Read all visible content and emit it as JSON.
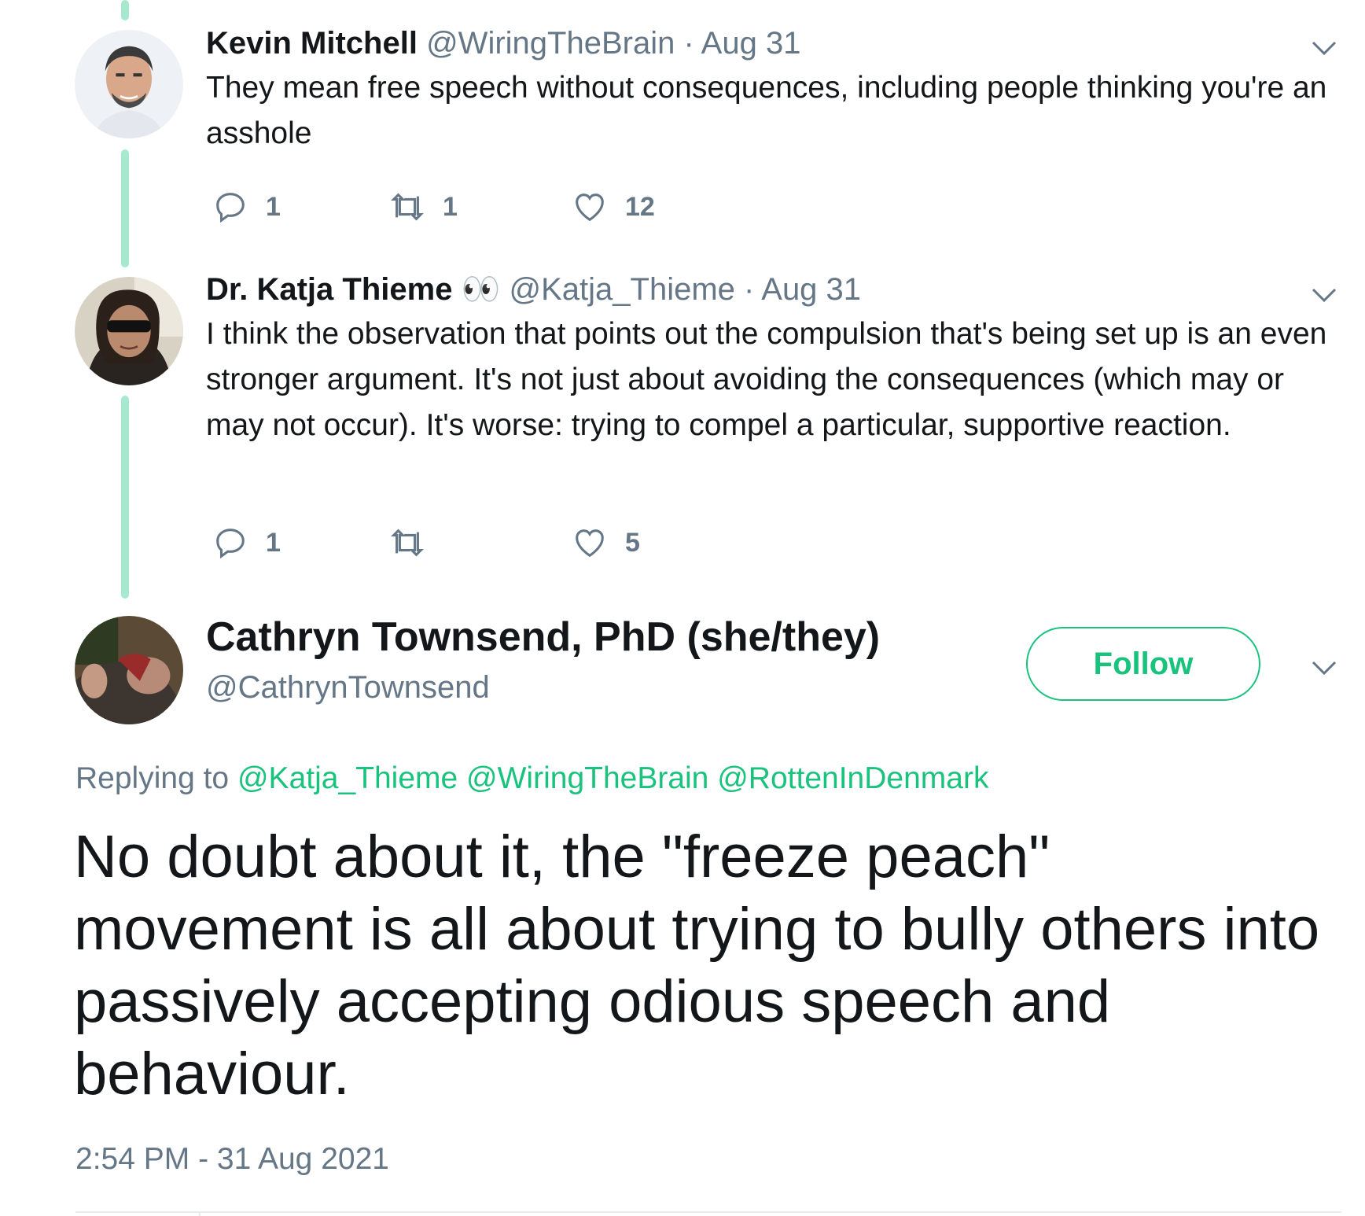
{
  "colors": {
    "accent": "#19c37d",
    "thread_line": "#a6e9cf",
    "muted": "#657786",
    "text": "#14171a"
  },
  "tweets": [
    {
      "name": "Kevin Mitchell",
      "handle": "@WiringTheBrain",
      "date": "· Aug 31",
      "text": "They mean free speech without consequences, including people thinking you're an asshole",
      "replies": "1",
      "retweets": "1",
      "likes": "12"
    },
    {
      "name": "Dr. Katja Thieme",
      "name_emoji": "👀",
      "handle": "@Katja_Thieme",
      "date": "· Aug 31",
      "text": "I think the observation that points out the compulsion that's being set up is an even stronger argument. It's not just about avoiding the consequences (which may or may not occur). It's worse: trying to compel a particular, supportive reaction.",
      "replies": "1",
      "retweets": "",
      "likes": "5"
    }
  ],
  "main_tweet": {
    "name": "Cathryn Townsend, PhD (she/they)",
    "handle": "@CathrynTownsend",
    "follow_label": "Follow",
    "replying_prefix": "Replying to",
    "mentions": [
      "@Katja_Thieme",
      "@WiringTheBrain",
      "@RottenInDenmark"
    ],
    "text": "No doubt about it, the \"freeze peach\" movement is all about trying to bully others into passively accepting odious speech and behaviour.",
    "timestamp": "2:54 PM - 31 Aug 2021"
  },
  "icons": [
    "reply-icon",
    "retweet-icon",
    "like-icon",
    "chevron-down-icon",
    "eyes-emoji"
  ]
}
